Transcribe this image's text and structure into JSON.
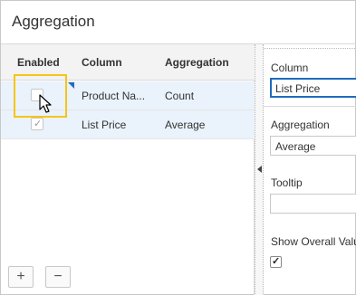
{
  "dialog": {
    "title": "Aggregation"
  },
  "grid": {
    "headers": {
      "enabled": "Enabled",
      "column": "Column",
      "aggregation": "Aggregation"
    },
    "rows": [
      {
        "enabled": false,
        "column": "Product Na...",
        "aggregation": "Count"
      },
      {
        "enabled": true,
        "column": "List Price",
        "aggregation": "Average"
      }
    ]
  },
  "toolbar": {
    "add_label": "+",
    "remove_label": "−"
  },
  "properties": {
    "column_label": "Column",
    "column_value": "List Price",
    "aggregation_label": "Aggregation",
    "aggregation_value": "Average",
    "tooltip_label": "Tooltip",
    "tooltip_value": "",
    "show_overall_label": "Show Overall Valu",
    "show_overall_checked": true
  },
  "icons": {
    "checkmark": "check-icon",
    "cursor": "mouse-pointer-icon",
    "collapse": "collapse-left-icon"
  },
  "colors": {
    "accent": "#1e6bbf",
    "highlight": "#f5c518",
    "row_selected": "#eaf2fb"
  }
}
